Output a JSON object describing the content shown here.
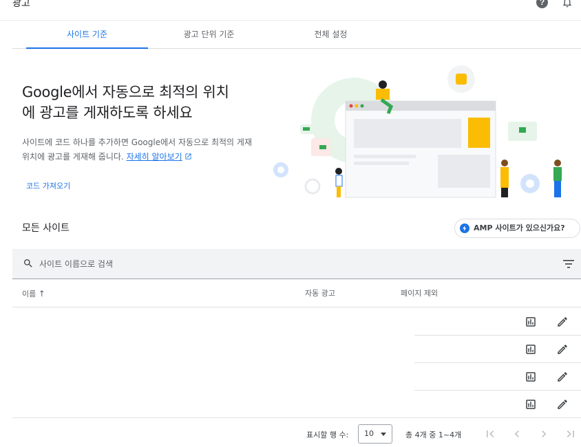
{
  "app": {
    "title": "광고",
    "help_icon": "help-icon",
    "bell_icon": "notification-bell-icon"
  },
  "tabs": [
    {
      "label": "사이트 기준",
      "active": true
    },
    {
      "label": "광고 단위 기준",
      "active": false
    },
    {
      "label": "전체 설정",
      "active": false
    }
  ],
  "hero": {
    "title_line1": "Google에서 자동으로 최적의 위치",
    "title_line2": "에 광고를 게재하도록 하세요",
    "desc": "사이트에 코드 하나를 추가하면 Google에서 자동으로 최적의 게재위치에 광고를 게재해 줍니다.",
    "learn_more": "자세히 알아보기",
    "get_code": "코드 가져오기"
  },
  "sites": {
    "title": "모든 사이트",
    "amp_prompt": "AMP 사이트가 있으신가요?",
    "search_placeholder": "사이트 이름으로 검색",
    "columns": {
      "name": "이름",
      "auto_ads": "자동 광고",
      "exclude_pages": "페이지 제외"
    },
    "rows": [
      {
        "actions": [
          "report-icon",
          "edit-icon"
        ]
      },
      {
        "actions": [
          "report-icon",
          "edit-icon"
        ]
      },
      {
        "actions": [
          "report-icon",
          "edit-icon"
        ]
      },
      {
        "actions": [
          "report-icon",
          "edit-icon"
        ]
      }
    ]
  },
  "pagination": {
    "rows_label": "표시할 행 수:",
    "rows_value": "10",
    "range": "총 4개 중 1~4개"
  },
  "colors": {
    "accent": "#1a73e8",
    "text": "#3c4043",
    "search_bg": "#f1f3f4",
    "illus_yellow": "#fbbc04",
    "illus_green": "#34a853"
  }
}
